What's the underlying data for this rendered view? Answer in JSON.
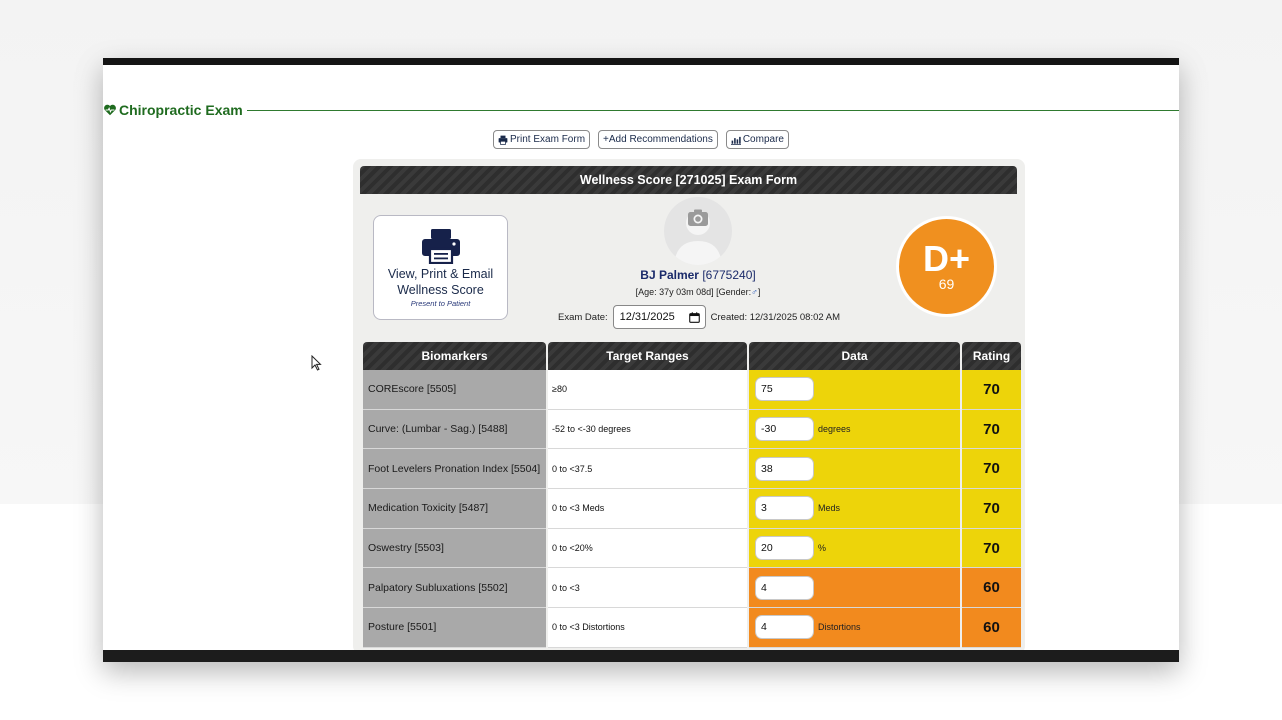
{
  "section": {
    "title": "Chiropractic Exam"
  },
  "toolbar": {
    "print_label": "Print Exam Form",
    "add_label": "+Add Recommendations",
    "compare_label": "Compare"
  },
  "form": {
    "title": "Wellness Score [271025] Exam Form",
    "view_card": {
      "title": "View, Print & Email Wellness Score",
      "subtitle": "Present to Patient"
    },
    "patient": {
      "name": "BJ Palmer",
      "id": "[6775240]",
      "age": "[Age: 37y 03m 08d]",
      "gender_prefix": "[Gender:",
      "gender_symbol": "♂",
      "gender_suffix": "]"
    },
    "exam_date_label": "Exam Date:",
    "exam_date_value": "12/31/2025",
    "created": "Created: 12/31/2025 08:02 AM",
    "grade": {
      "letter": "D+",
      "score": "69"
    }
  },
  "table": {
    "headers": {
      "biomarkers": "Biomarkers",
      "ranges": "Target Ranges",
      "data": "Data",
      "rating": "Rating"
    },
    "rows": [
      {
        "name": "COREscore [5505]",
        "range": "≥80",
        "value": "75",
        "unit": "",
        "rating": "70",
        "level": "yellow"
      },
      {
        "name": "Curve: (Lumbar - Sag.) [5488]",
        "range": "-52 to <-30 degrees",
        "value": "-30",
        "unit": "degrees",
        "rating": "70",
        "level": "yellow"
      },
      {
        "name": "Foot Levelers Pronation Index [5504]",
        "range": "0 to <37.5",
        "value": "38",
        "unit": "",
        "rating": "70",
        "level": "yellow"
      },
      {
        "name": "Medication Toxicity [5487]",
        "range": "0 to <3 Meds",
        "value": "3",
        "unit": "Meds",
        "rating": "70",
        "level": "yellow"
      },
      {
        "name": "Oswestry [5503]",
        "range": "0 to <20%",
        "value": "20",
        "unit": "%",
        "rating": "70",
        "level": "yellow"
      },
      {
        "name": "Palpatory Subluxations [5502]",
        "range": "0 to <3",
        "value": "4",
        "unit": "",
        "rating": "60",
        "level": "orange"
      },
      {
        "name": "Posture [5501]",
        "range": "0 to <3 Distortions",
        "value": "4",
        "unit": "Distortions",
        "rating": "60",
        "level": "orange"
      }
    ]
  },
  "colors": {
    "accent_green": "#1f6b1f",
    "grade_orange": "#f0901f",
    "yellow": "#edd40a",
    "orange": "#f28a1e"
  },
  "icons": {
    "section": "heartbeat-icon",
    "print": "print-icon",
    "compare": "chart-icon",
    "calendar": "calendar-icon",
    "avatar": "camera-icon"
  }
}
